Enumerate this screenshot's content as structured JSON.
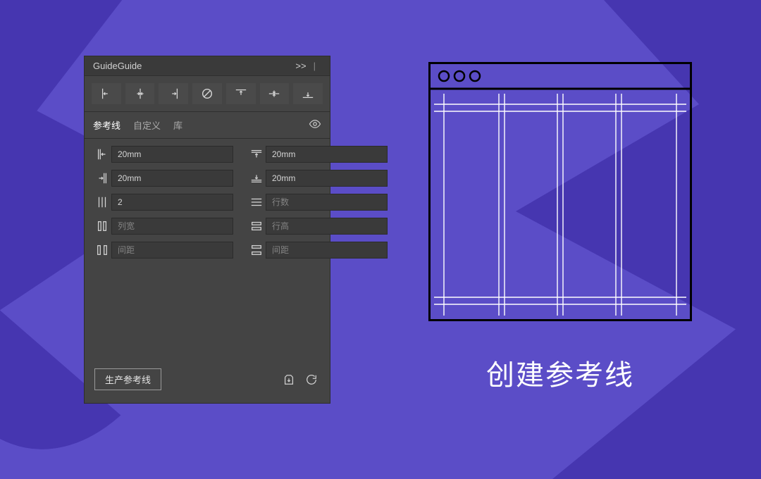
{
  "panel": {
    "title": "GuideGuide",
    "collapse_label": ">>",
    "tabs": {
      "guides": "参考线",
      "custom": "自定义",
      "library": "库"
    },
    "fields": {
      "left_margin": {
        "value": "20mm"
      },
      "top_margin": {
        "value": "20mm"
      },
      "right_margin": {
        "value": "20mm"
      },
      "bottom_margin": {
        "value": "20mm"
      },
      "columns": {
        "value": "2"
      },
      "rows": {
        "placeholder": "行数"
      },
      "column_width": {
        "placeholder": "列宽"
      },
      "row_height": {
        "placeholder": "行高"
      },
      "column_gutter": {
        "placeholder": "间距"
      },
      "row_gutter": {
        "placeholder": "间距"
      }
    },
    "generate_label": "生产参考线"
  },
  "caption": "创建参考线"
}
